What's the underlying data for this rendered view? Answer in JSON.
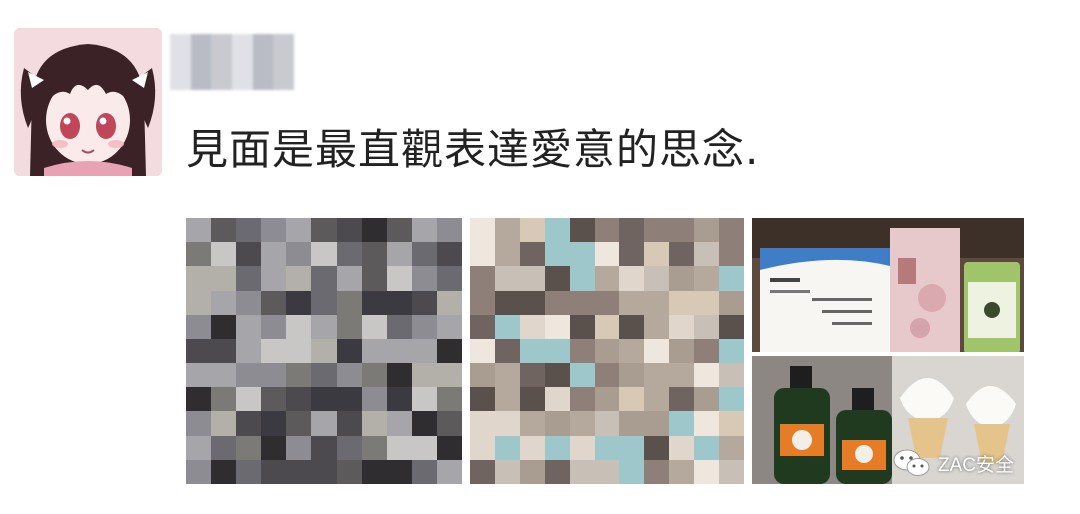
{
  "post": {
    "text": "見面是最直觀表達愛意的思念."
  },
  "photos": [
    {
      "label": "blurred-photo-couple"
    },
    {
      "label": "blurred-photo-selfie"
    },
    {
      "label": "photo-drinks-and-icecream"
    }
  ],
  "watermark": {
    "text": "ZAC安全",
    "icon": "wechat-icon"
  }
}
